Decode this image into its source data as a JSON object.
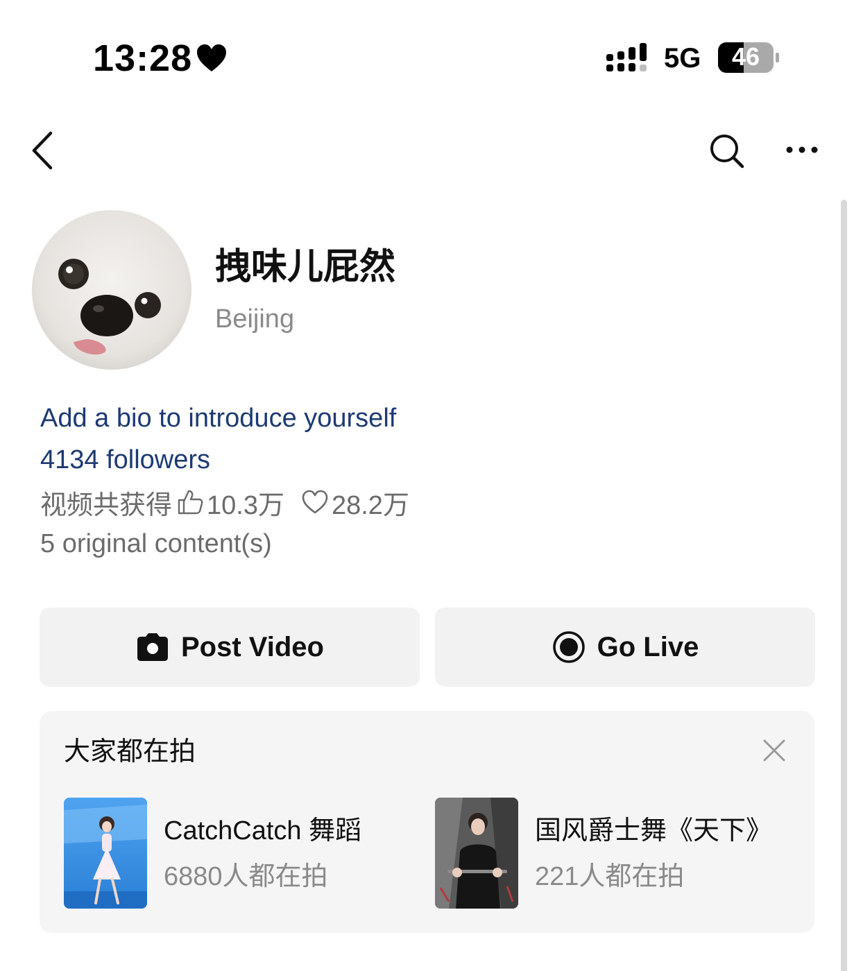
{
  "status_bar": {
    "time": "13:28",
    "network": "5G",
    "battery": "46"
  },
  "icons": {
    "heart": "heart-icon",
    "signal": "signal-icon",
    "battery": "battery-icon",
    "back": "chevron-left-icon",
    "search": "search-icon",
    "more": "more-icon",
    "like": "thumbs-up-icon",
    "favorite": "heart-outline-icon",
    "camera": "camera-icon",
    "live": "record-icon",
    "close": "close-icon"
  },
  "profile": {
    "username": "拽味儿屁然",
    "location": "Beijing",
    "bio": "Add a bio to introduce yourself",
    "followers": "4134 followers",
    "stats_label": "视频共获得",
    "likes": "10.3万",
    "favorites": "28.2万",
    "original_content": "5 original content(s)"
  },
  "actions": {
    "post_video": "Post Video",
    "go_live": "Go Live"
  },
  "suggestions": {
    "title": "大家都在拍",
    "items": [
      {
        "name": "CatchCatch 舞蹈",
        "count": "6880人都在拍"
      },
      {
        "name": "国风爵士舞《天下》",
        "count": "221人都在拍"
      }
    ]
  },
  "colors": {
    "link_blue": "#1d3a73",
    "secondary_gray": "#8a8a8a",
    "button_bg": "#f2f2f2",
    "card_bg": "#f5f5f5"
  }
}
